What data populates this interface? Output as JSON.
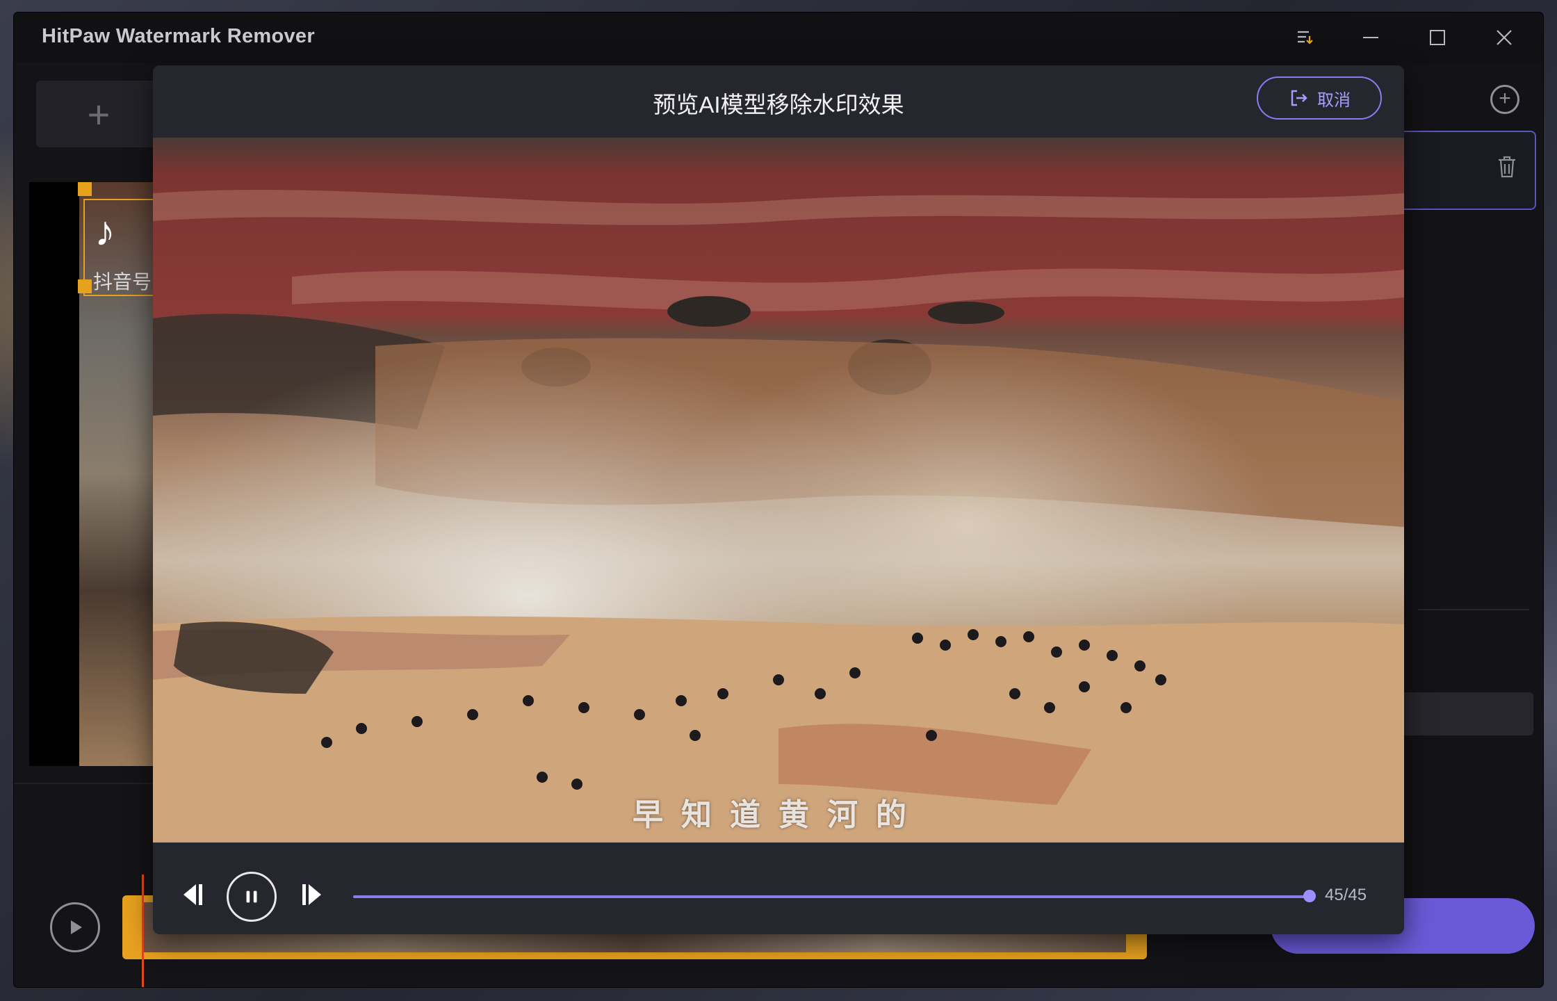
{
  "app": {
    "title": "HitPaw Watermark Remover"
  },
  "background_ui": {
    "add_label": "+",
    "watermark_brand": "抖音号",
    "add_circle_label": "+"
  },
  "modal": {
    "title": "预览AI模型移除水印效果",
    "cancel_label": "取消",
    "video_caption": "早知道黄河的",
    "player": {
      "counter": "45/45",
      "progress": 1.0
    }
  },
  "colors": {
    "accent": "#8b7cf0",
    "selection": "#e7a21d",
    "window_bg": "#141418",
    "modal_bg": "#26272e"
  },
  "icons": {
    "menu": "menu-arrow-icon",
    "minimize": "minimize-icon",
    "maximize": "maximize-icon",
    "close": "close-icon",
    "cancel": "exit-icon",
    "prev_frame": "step-back-icon",
    "pause": "pause-icon",
    "next_frame": "step-forward-icon"
  }
}
